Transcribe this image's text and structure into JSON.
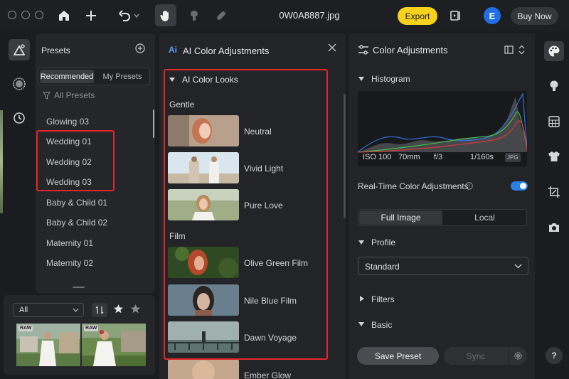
{
  "window": {
    "filename": "0W0A8887.jpg"
  },
  "toolbar": {
    "export_label": "Export",
    "avatar_letter": "E",
    "buy_label": "Buy Now"
  },
  "presets": {
    "title": "Presets",
    "tabs": [
      "Recommended",
      "My Presets"
    ],
    "filter_label": "All Presets",
    "items": [
      "Glowing 03",
      "Wedding 01",
      "Wedding 02",
      "Wedding 03",
      "Baby & Child 01",
      "Baby & Child 02",
      "Maternity 01",
      "Maternity 02"
    ]
  },
  "filmstrip": {
    "filter_value": "All",
    "badge": "RAW"
  },
  "ai_panel": {
    "badge": "Ai",
    "title": "AI Color Adjustments",
    "section": "AI Color Looks",
    "groups": {
      "gentle": {
        "label": "Gentle",
        "looks": [
          "Neutral",
          "Vivid Light",
          "Pure Love"
        ]
      },
      "film": {
        "label": "Film",
        "looks": [
          "Olive Green Film",
          "Nile Blue Film",
          "Dawn Voyage",
          "Ember Glow"
        ]
      }
    }
  },
  "color_panel": {
    "title": "Color Adjustments",
    "histogram": {
      "label": "Histogram",
      "iso": "ISO 100",
      "focal": "70mm",
      "aperture": "f/3",
      "shutter": "1/160s",
      "format": "JPG"
    },
    "realtime_label": "Real-Time Color Adjustments",
    "realtime_on": true,
    "segments": [
      "Full Image",
      "Local"
    ],
    "profile": {
      "label": "Profile",
      "value": "Standard"
    },
    "filters_label": "Filters",
    "basic_label": "Basic",
    "save_preset_label": "Save Preset",
    "sync_label": "Sync"
  },
  "help_label": "?",
  "colors": {
    "accent_yellow": "#f6d21c",
    "accent_blue": "#2b7fe8",
    "highlight_red": "#e3262b"
  }
}
